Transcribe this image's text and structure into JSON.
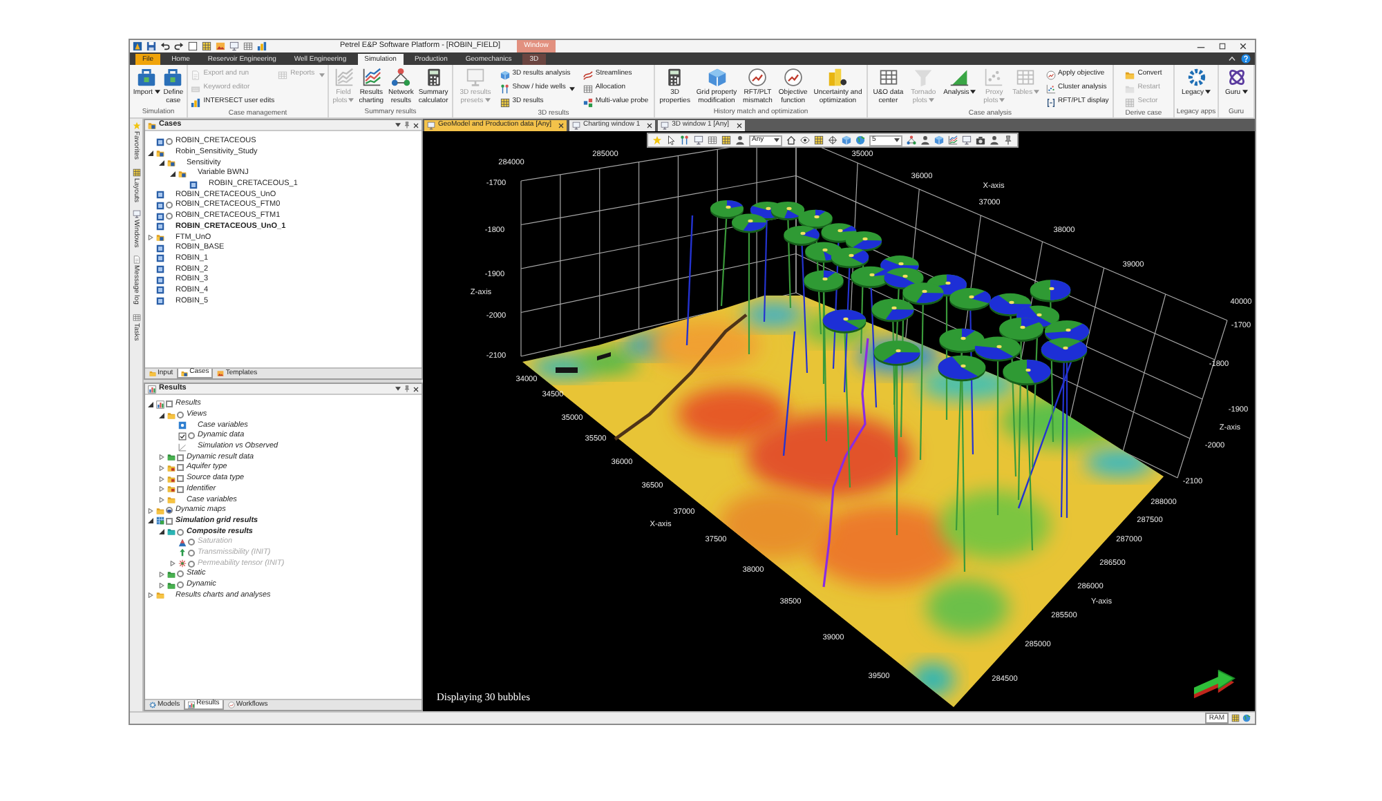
{
  "window": {
    "title": "Petrel E&P Software Platform - [ROBIN_FIELD]",
    "context_label": "Window"
  },
  "ribbon_tabs": [
    {
      "label": "File",
      "kind": "file",
      "selected": false
    },
    {
      "label": "Home",
      "kind": "tab",
      "selected": false
    },
    {
      "label": "Reservoir Engineering",
      "kind": "tab",
      "selected": false
    },
    {
      "label": "Well Engineering",
      "kind": "tab",
      "selected": false
    },
    {
      "label": "Simulation",
      "kind": "tab",
      "selected": true
    },
    {
      "label": "Production",
      "kind": "tab",
      "selected": false
    },
    {
      "label": "Geomechanics",
      "kind": "tab",
      "selected": false
    },
    {
      "label": "3D",
      "kind": "context",
      "selected": false
    }
  ],
  "ribbon_groups": [
    {
      "label": "Simulation",
      "items": [
        {
          "kind": "large",
          "label": "Import",
          "dropdown": true,
          "disabled": false
        },
        {
          "kind": "large",
          "label": "Define\ncase",
          "dropdown": false,
          "disabled": false
        }
      ]
    },
    {
      "label": "Case management",
      "items": [
        {
          "kind": "small",
          "label": "Export and run",
          "dropdown": false,
          "disabled": true
        },
        {
          "kind": "small",
          "label": "Keyword editor",
          "dropdown": false,
          "disabled": true
        },
        {
          "kind": "small",
          "label": "INTERSECT user edits",
          "dropdown": false,
          "disabled": false
        },
        {
          "kind": "small",
          "label": "Reports",
          "dropdown": true,
          "disabled": true
        }
      ]
    },
    {
      "label": "Summary results",
      "items": [
        {
          "kind": "large",
          "label": "Field\nplots",
          "dropdown": true,
          "disabled": true
        },
        {
          "kind": "large",
          "label": "Results\ncharting",
          "dropdown": false,
          "disabled": false
        },
        {
          "kind": "large",
          "label": "Network\nresults",
          "dropdown": false,
          "disabled": false
        },
        {
          "kind": "large",
          "label": "Summary\ncalculator",
          "dropdown": false,
          "disabled": false
        }
      ]
    },
    {
      "label": "3D results",
      "items": [
        {
          "kind": "large",
          "label": "3D results\npresets",
          "dropdown": true,
          "disabled": true
        },
        {
          "kind": "small",
          "label": "3D results analysis",
          "dropdown": false,
          "disabled": false
        },
        {
          "kind": "small",
          "label": "Show / hide wells",
          "dropdown": true,
          "disabled": false
        },
        {
          "kind": "small",
          "label": "3D results",
          "dropdown": false,
          "disabled": false
        },
        {
          "kind": "small",
          "label": "Streamlines",
          "dropdown": false,
          "disabled": false
        },
        {
          "kind": "small",
          "label": "Allocation",
          "dropdown": false,
          "disabled": false
        },
        {
          "kind": "small",
          "label": "Multi-value probe",
          "dropdown": false,
          "disabled": false
        }
      ]
    },
    {
      "label": "History match and optimization",
      "items": [
        {
          "kind": "large",
          "label": "3D\nproperties",
          "dropdown": false,
          "disabled": false
        },
        {
          "kind": "large",
          "label": "Grid property\nmodification",
          "dropdown": false,
          "disabled": false
        },
        {
          "kind": "large",
          "label": "RFT/PLT\nmismatch",
          "dropdown": false,
          "disabled": false
        },
        {
          "kind": "large",
          "label": "Objective\nfunction",
          "dropdown": false,
          "disabled": false
        },
        {
          "kind": "large",
          "label": "Uncertainty and\noptimization",
          "dropdown": false,
          "disabled": false
        }
      ]
    },
    {
      "label": "Case analysis",
      "items": [
        {
          "kind": "large",
          "label": "U&O data\ncenter",
          "dropdown": false,
          "disabled": false
        },
        {
          "kind": "large",
          "label": "Tornado\nplots",
          "dropdown": true,
          "disabled": true
        },
        {
          "kind": "large",
          "label": "Analysis",
          "dropdown": true,
          "disabled": false
        },
        {
          "kind": "large",
          "label": "Proxy\nplots",
          "dropdown": true,
          "disabled": true
        },
        {
          "kind": "large",
          "label": "Tables",
          "dropdown": true,
          "disabled": true
        },
        {
          "kind": "small",
          "label": "Apply objective",
          "dropdown": false,
          "disabled": false
        },
        {
          "kind": "small",
          "label": "Cluster analysis",
          "dropdown": false,
          "disabled": false
        },
        {
          "kind": "small",
          "label": "RFT/PLT display",
          "dropdown": false,
          "disabled": false
        }
      ]
    },
    {
      "label": "Derive case",
      "items": [
        {
          "kind": "small",
          "label": "Convert",
          "dropdown": false,
          "disabled": false
        },
        {
          "kind": "small",
          "label": "Restart",
          "dropdown": false,
          "disabled": true
        },
        {
          "kind": "small",
          "label": "Sector",
          "dropdown": false,
          "disabled": true
        }
      ]
    },
    {
      "label": "Legacy apps",
      "items": [
        {
          "kind": "large",
          "label": "Legacy",
          "dropdown": true,
          "disabled": false
        }
      ]
    },
    {
      "label": "Guru",
      "items": [
        {
          "kind": "large",
          "label": "Guru",
          "dropdown": true,
          "disabled": false
        }
      ]
    }
  ],
  "side_tabs": [
    {
      "label": "Favorites",
      "selected": false
    },
    {
      "label": "Layouts",
      "selected": false
    },
    {
      "label": "Windows",
      "selected": false
    },
    {
      "label": "Message log",
      "selected": false
    },
    {
      "label": "Tasks",
      "selected": false
    }
  ],
  "cases_panel": {
    "title": "Cases",
    "tree": [
      {
        "label": "ROBIN_CRETACEOUS",
        "kind": "case",
        "toggle": {
          "kind": "radio",
          "checked": false
        },
        "active": false
      },
      {
        "label": "Robin_Sensitivity_Study",
        "kind": "study",
        "expanded": true,
        "active": false,
        "children": [
          {
            "label": "Sensitivity",
            "kind": "study",
            "expanded": true,
            "active": false,
            "children": [
              {
                "label": "Variable BWNJ",
                "kind": "study",
                "expanded": true,
                "active": false,
                "children": [
                  {
                    "label": "ROBIN_CRETACEOUS_1",
                    "kind": "case",
                    "active": false
                  }
                ]
              }
            ]
          }
        ]
      },
      {
        "label": "ROBIN_CRETACEOUS_UnO",
        "kind": "case",
        "active": false
      },
      {
        "label": "ROBIN_CRETACEOUS_FTM0",
        "kind": "case",
        "toggle": {
          "kind": "radio",
          "checked": false
        },
        "active": false
      },
      {
        "label": "ROBIN_CRETACEOUS_FTM1",
        "kind": "case",
        "toggle": {
          "kind": "radio",
          "checked": false
        },
        "active": false
      },
      {
        "label": "ROBIN_CRETACEOUS_UnO_1",
        "kind": "case",
        "active": true
      },
      {
        "label": "FTM_UnO",
        "kind": "study",
        "expanded": false,
        "active": false
      },
      {
        "label": "ROBIN_BASE",
        "kind": "case",
        "active": false
      },
      {
        "label": "ROBIN_1",
        "kind": "case",
        "active": false
      },
      {
        "label": "ROBIN_2",
        "kind": "case",
        "active": false
      },
      {
        "label": "ROBIN_3",
        "kind": "case",
        "active": false
      },
      {
        "label": "ROBIN_4",
        "kind": "case",
        "active": false
      },
      {
        "label": "ROBIN_5",
        "kind": "case",
        "active": false
      }
    ],
    "tabs": [
      {
        "label": "Input",
        "selected": false
      },
      {
        "label": "Cases",
        "selected": true
      },
      {
        "label": "Templates",
        "selected": false
      }
    ]
  },
  "results_panel": {
    "title": "Results",
    "tree": [
      {
        "label": "Results",
        "kind": "root",
        "toggle": {
          "kind": "checkbox",
          "checked": false
        },
        "expanded": true,
        "active": false,
        "disabled": false,
        "children": [
          {
            "label": "Views",
            "kind": "folder",
            "toggle": {
              "kind": "radio",
              "checked": false
            },
            "expanded": true,
            "active": false,
            "disabled": false,
            "children": [
              {
                "label": "Case variables",
                "kind": "variable",
                "active": false,
                "disabled": false
              },
              {
                "label": "Dynamic data",
                "kind": "toggle",
                "toggle": {
                  "kind": "radio",
                  "checked": false
                },
                "active": false,
                "disabled": false
              },
              {
                "label": "Simulation vs Observed",
                "kind": "crossplot",
                "active": false,
                "disabled": false
              }
            ]
          },
          {
            "label": "Dynamic result data",
            "kind": "greenfolder",
            "toggle": {
              "kind": "checkbox",
              "checked": false
            },
            "expanded": false,
            "active": false,
            "disabled": false
          },
          {
            "label": "Aquifer type",
            "kind": "filterfolder",
            "toggle": {
              "kind": "checkbox",
              "checked": false
            },
            "expanded": false,
            "active": false,
            "disabled": false
          },
          {
            "label": "Source data type",
            "kind": "filterfolder",
            "toggle": {
              "kind": "checkbox",
              "checked": false
            },
            "expanded": false,
            "active": false,
            "disabled": false
          },
          {
            "label": "Identifier",
            "kind": "filterfolder",
            "toggle": {
              "kind": "checkbox",
              "checked": false
            },
            "expanded": false,
            "active": false,
            "disabled": false
          },
          {
            "label": "Case variables",
            "kind": "folder",
            "expanded": false,
            "active": false,
            "disabled": false
          }
        ]
      },
      {
        "label": "Dynamic maps",
        "kind": "folder",
        "toggle": {
          "kind": "radio",
          "checked": true
        },
        "expanded": false,
        "active": false,
        "disabled": false
      },
      {
        "label": "Simulation grid results",
        "kind": "gridresults",
        "toggle": {
          "kind": "checkbox",
          "checked": false
        },
        "expanded": true,
        "active": true,
        "disabled": false,
        "children": [
          {
            "label": "Composite results",
            "kind": "tealfolder",
            "toggle": {
              "kind": "radio",
              "checked": false
            },
            "expanded": true,
            "active": true,
            "disabled": false,
            "children": [
              {
                "label": "Saturation",
                "kind": "saturation",
                "toggle": {
                  "kind": "radio",
                  "checked": false
                },
                "active": false,
                "disabled": true
              },
              {
                "label": "Transmissibility (INIT)",
                "kind": "vector",
                "toggle": {
                  "kind": "radio",
                  "checked": false
                },
                "active": false,
                "disabled": true
              },
              {
                "label": "Permeability tensor (INIT)",
                "kind": "tensor",
                "toggle": {
                  "kind": "radio",
                  "checked": false
                },
                "expanded": false,
                "active": false,
                "disabled": true
              }
            ]
          },
          {
            "label": "Static",
            "kind": "greenfolder",
            "toggle": {
              "kind": "radio",
              "checked": false
            },
            "expanded": false,
            "active": false,
            "disabled": false
          },
          {
            "label": "Dynamic",
            "kind": "greenfolder",
            "toggle": {
              "kind": "radio",
              "checked": false
            },
            "expanded": false,
            "active": false,
            "disabled": false
          }
        ]
      },
      {
        "label": "Results charts and analyses",
        "kind": "folder",
        "expanded": false,
        "active": false,
        "disabled": false
      }
    ],
    "tabs": [
      {
        "label": "Models",
        "selected": false
      },
      {
        "label": "Results",
        "selected": true
      },
      {
        "label": "Workflows",
        "selected": false
      }
    ]
  },
  "document_tabs": [
    {
      "label": "GeoModel and Production data [Any]",
      "selected": true
    },
    {
      "label": "Charting window 1",
      "selected": false
    },
    {
      "label": "3D window 1 [Any]",
      "selected": false
    }
  ],
  "view_toolbar": {
    "dropdowns": [
      {
        "value": "Any"
      },
      {
        "value": "5"
      }
    ]
  },
  "viewport": {
    "axes": [
      {
        "title": "Z-axis",
        "ticks": [
          "-1700",
          "-1800",
          "-1900",
          "-2000",
          "-2100"
        ]
      },
      {
        "ticks": [
          "284000",
          "285000"
        ]
      },
      {
        "title": "X-axis",
        "ticks": [
          "35000",
          "36000",
          "37000",
          "38000",
          "39000",
          "40000"
        ]
      },
      {
        "title": "Z-axis",
        "ticks": [
          "-1700",
          "-1800",
          "-1900",
          "-2000",
          "-2100"
        ]
      },
      {
        "title": "X-axis",
        "ticks": [
          "34000",
          "34500",
          "35000",
          "35500",
          "36000",
          "36500",
          "37000",
          "37500",
          "38000",
          "38500",
          "39000",
          "39500"
        ]
      },
      {
        "title": "Y-axis",
        "ticks": [
          "288000",
          "287500",
          "287000",
          "286500",
          "286000",
          "285500",
          "285000",
          "284500"
        ]
      }
    ],
    "caption": "Displaying 30 bubbles"
  },
  "status_bar": {
    "memory_label": "RAM"
  }
}
